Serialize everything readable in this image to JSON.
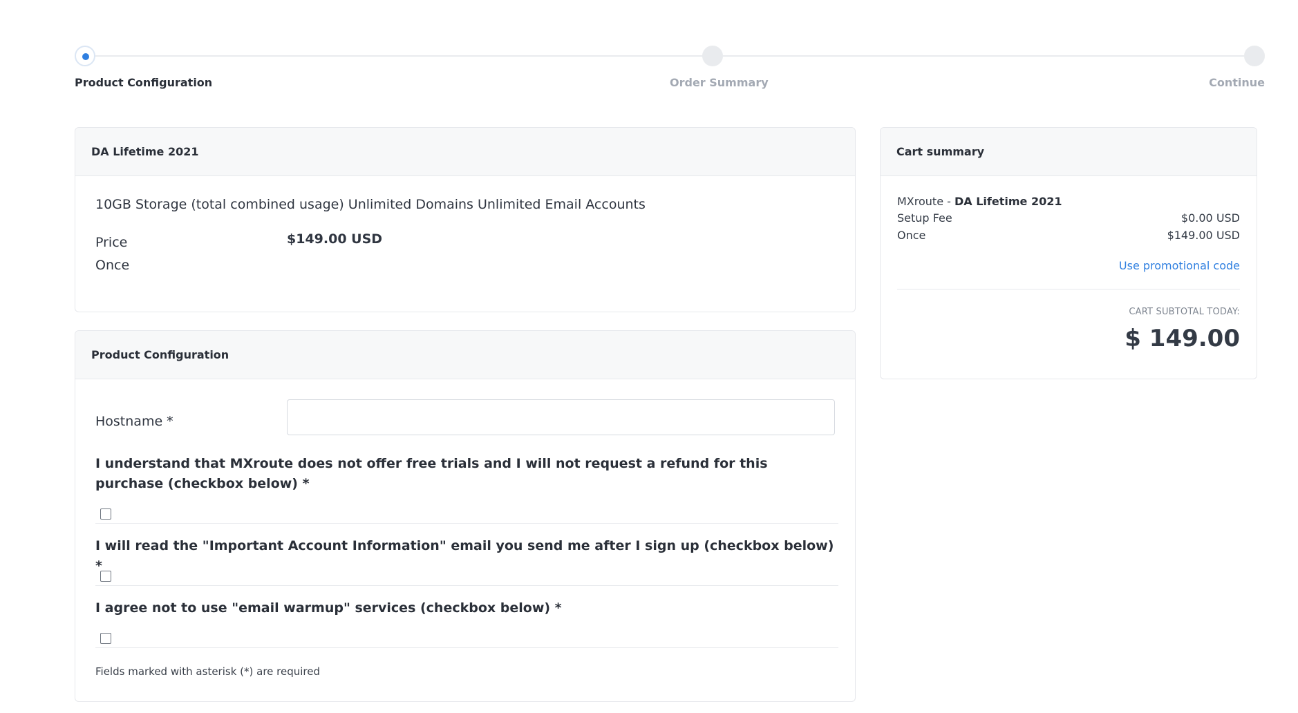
{
  "stepper": {
    "steps": [
      {
        "label": "Product Configuration",
        "state": "active"
      },
      {
        "label": "Order Summary",
        "state": "inactive"
      },
      {
        "label": "Continue",
        "state": "inactive"
      }
    ],
    "accent_color": "#2f7fe0"
  },
  "product_card": {
    "title": "DA Lifetime 2021",
    "description": "10GB Storage (total combined usage) Unlimited Domains Unlimited Email Accounts",
    "price_label": "Price",
    "price_value": "$149.00 USD",
    "cycle_label": "Once"
  },
  "config_card": {
    "title": "Product Configuration",
    "hostname_label": "Hostname *",
    "hostname_value": "",
    "hostname_placeholder": "",
    "questions": [
      {
        "text": "I understand that MXroute does not offer free trials and I will not request a refund for this purchase (checkbox below) *",
        "checked": false
      },
      {
        "text": "I will read the \"Important Account Information\" email you send me after I sign up (checkbox below) *",
        "checked": false
      },
      {
        "text": "I agree not to use \"email warmup\" services (checkbox below) *",
        "checked": false
      }
    ],
    "required_note": "Fields marked with asterisk (*) are required"
  },
  "cart_summary": {
    "title": "Cart summary",
    "vendor": "MXroute",
    "separator": " - ",
    "product": "DA Lifetime 2021",
    "setup_fee_label": "Setup Fee",
    "setup_fee_value": "$0.00 USD",
    "once_label": "Once",
    "once_value": "$149.00 USD",
    "promo_link": "Use promotional code",
    "subtotal_label": "CART SUBTOTAL TODAY:",
    "subtotal_value": "$ 149.00"
  }
}
